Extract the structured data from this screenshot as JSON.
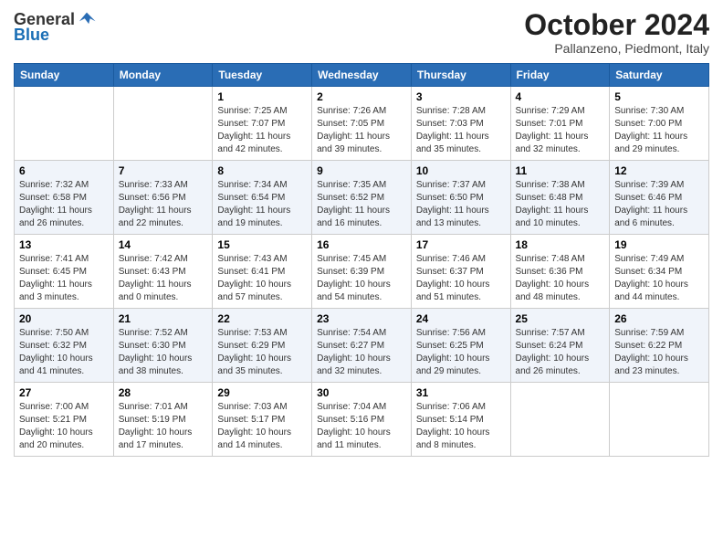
{
  "header": {
    "logo_line1": "General",
    "logo_line2": "Blue",
    "month_title": "October 2024",
    "location": "Pallanzeno, Piedmont, Italy"
  },
  "weekdays": [
    "Sunday",
    "Monday",
    "Tuesday",
    "Wednesday",
    "Thursday",
    "Friday",
    "Saturday"
  ],
  "weeks": [
    [
      {
        "day": "",
        "info": ""
      },
      {
        "day": "",
        "info": ""
      },
      {
        "day": "1",
        "info": "Sunrise: 7:25 AM\nSunset: 7:07 PM\nDaylight: 11 hours and 42 minutes."
      },
      {
        "day": "2",
        "info": "Sunrise: 7:26 AM\nSunset: 7:05 PM\nDaylight: 11 hours and 39 minutes."
      },
      {
        "day": "3",
        "info": "Sunrise: 7:28 AM\nSunset: 7:03 PM\nDaylight: 11 hours and 35 minutes."
      },
      {
        "day": "4",
        "info": "Sunrise: 7:29 AM\nSunset: 7:01 PM\nDaylight: 11 hours and 32 minutes."
      },
      {
        "day": "5",
        "info": "Sunrise: 7:30 AM\nSunset: 7:00 PM\nDaylight: 11 hours and 29 minutes."
      }
    ],
    [
      {
        "day": "6",
        "info": "Sunrise: 7:32 AM\nSunset: 6:58 PM\nDaylight: 11 hours and 26 minutes."
      },
      {
        "day": "7",
        "info": "Sunrise: 7:33 AM\nSunset: 6:56 PM\nDaylight: 11 hours and 22 minutes."
      },
      {
        "day": "8",
        "info": "Sunrise: 7:34 AM\nSunset: 6:54 PM\nDaylight: 11 hours and 19 minutes."
      },
      {
        "day": "9",
        "info": "Sunrise: 7:35 AM\nSunset: 6:52 PM\nDaylight: 11 hours and 16 minutes."
      },
      {
        "day": "10",
        "info": "Sunrise: 7:37 AM\nSunset: 6:50 PM\nDaylight: 11 hours and 13 minutes."
      },
      {
        "day": "11",
        "info": "Sunrise: 7:38 AM\nSunset: 6:48 PM\nDaylight: 11 hours and 10 minutes."
      },
      {
        "day": "12",
        "info": "Sunrise: 7:39 AM\nSunset: 6:46 PM\nDaylight: 11 hours and 6 minutes."
      }
    ],
    [
      {
        "day": "13",
        "info": "Sunrise: 7:41 AM\nSunset: 6:45 PM\nDaylight: 11 hours and 3 minutes."
      },
      {
        "day": "14",
        "info": "Sunrise: 7:42 AM\nSunset: 6:43 PM\nDaylight: 11 hours and 0 minutes."
      },
      {
        "day": "15",
        "info": "Sunrise: 7:43 AM\nSunset: 6:41 PM\nDaylight: 10 hours and 57 minutes."
      },
      {
        "day": "16",
        "info": "Sunrise: 7:45 AM\nSunset: 6:39 PM\nDaylight: 10 hours and 54 minutes."
      },
      {
        "day": "17",
        "info": "Sunrise: 7:46 AM\nSunset: 6:37 PM\nDaylight: 10 hours and 51 minutes."
      },
      {
        "day": "18",
        "info": "Sunrise: 7:48 AM\nSunset: 6:36 PM\nDaylight: 10 hours and 48 minutes."
      },
      {
        "day": "19",
        "info": "Sunrise: 7:49 AM\nSunset: 6:34 PM\nDaylight: 10 hours and 44 minutes."
      }
    ],
    [
      {
        "day": "20",
        "info": "Sunrise: 7:50 AM\nSunset: 6:32 PM\nDaylight: 10 hours and 41 minutes."
      },
      {
        "day": "21",
        "info": "Sunrise: 7:52 AM\nSunset: 6:30 PM\nDaylight: 10 hours and 38 minutes."
      },
      {
        "day": "22",
        "info": "Sunrise: 7:53 AM\nSunset: 6:29 PM\nDaylight: 10 hours and 35 minutes."
      },
      {
        "day": "23",
        "info": "Sunrise: 7:54 AM\nSunset: 6:27 PM\nDaylight: 10 hours and 32 minutes."
      },
      {
        "day": "24",
        "info": "Sunrise: 7:56 AM\nSunset: 6:25 PM\nDaylight: 10 hours and 29 minutes."
      },
      {
        "day": "25",
        "info": "Sunrise: 7:57 AM\nSunset: 6:24 PM\nDaylight: 10 hours and 26 minutes."
      },
      {
        "day": "26",
        "info": "Sunrise: 7:59 AM\nSunset: 6:22 PM\nDaylight: 10 hours and 23 minutes."
      }
    ],
    [
      {
        "day": "27",
        "info": "Sunrise: 7:00 AM\nSunset: 5:21 PM\nDaylight: 10 hours and 20 minutes."
      },
      {
        "day": "28",
        "info": "Sunrise: 7:01 AM\nSunset: 5:19 PM\nDaylight: 10 hours and 17 minutes."
      },
      {
        "day": "29",
        "info": "Sunrise: 7:03 AM\nSunset: 5:17 PM\nDaylight: 10 hours and 14 minutes."
      },
      {
        "day": "30",
        "info": "Sunrise: 7:04 AM\nSunset: 5:16 PM\nDaylight: 10 hours and 11 minutes."
      },
      {
        "day": "31",
        "info": "Sunrise: 7:06 AM\nSunset: 5:14 PM\nDaylight: 10 hours and 8 minutes."
      },
      {
        "day": "",
        "info": ""
      },
      {
        "day": "",
        "info": ""
      }
    ]
  ]
}
